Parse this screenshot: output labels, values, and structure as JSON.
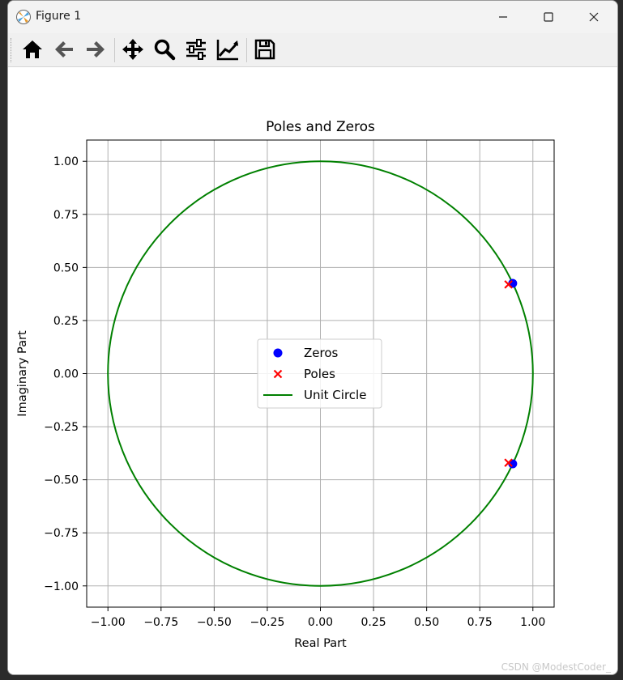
{
  "window": {
    "title": "Figure 1",
    "icons": {
      "app": "matplotlib-figure-icon",
      "minimize": "minimize-icon",
      "maximize": "maximize-icon",
      "close": "close-icon"
    }
  },
  "toolbar": {
    "buttons": [
      {
        "name": "home-button",
        "icon": "home-icon"
      },
      {
        "name": "back-button",
        "icon": "arrow-left-icon"
      },
      {
        "name": "forward-button",
        "icon": "arrow-right-icon"
      },
      {
        "name": "pan-button",
        "icon": "move-icon"
      },
      {
        "name": "zoom-button",
        "icon": "magnifier-icon"
      },
      {
        "name": "subplots-button",
        "icon": "sliders-icon"
      },
      {
        "name": "axes-edit-button",
        "icon": "line-chart-icon"
      },
      {
        "name": "save-button",
        "icon": "floppy-disk-icon"
      }
    ]
  },
  "watermark": "CSDN @ModestCoder_",
  "colors": {
    "zeros": "#0000ff",
    "poles": "#ff0000",
    "unit_circle": "#008000",
    "grid": "#b0b0b0"
  },
  "chart_data": {
    "type": "scatter",
    "title": "Poles and Zeros",
    "xlabel": "Real Part",
    "ylabel": "Imaginary Part",
    "xlim": [
      -1.1,
      1.1
    ],
    "ylim": [
      -1.1,
      1.1
    ],
    "xticks": [
      -1.0,
      -0.75,
      -0.5,
      -0.25,
      0.0,
      0.25,
      0.5,
      0.75,
      1.0
    ],
    "yticks": [
      1.0,
      0.75,
      0.5,
      0.25,
      0.0,
      -0.25,
      -0.5,
      -0.75,
      -1.0
    ],
    "xtick_labels": [
      "−1.00",
      "−0.75",
      "−0.50",
      "−0.25",
      "0.00",
      "0.25",
      "0.50",
      "0.75",
      "1.00"
    ],
    "ytick_labels": [
      "1.00",
      "0.75",
      "0.50",
      "0.25",
      "0.00",
      "−0.25",
      "−0.50",
      "−0.75",
      "−1.00"
    ],
    "grid": true,
    "legend_position": "center",
    "series": [
      {
        "name": "Zeros",
        "marker": "circle",
        "color": "#0000ff",
        "points": [
          {
            "x": 0.905,
            "y": 0.425
          },
          {
            "x": 0.905,
            "y": -0.425
          }
        ]
      },
      {
        "name": "Poles",
        "marker": "x",
        "color": "#ff0000",
        "points": [
          {
            "x": 0.885,
            "y": 0.42
          },
          {
            "x": 0.885,
            "y": -0.42
          }
        ]
      },
      {
        "name": "Unit Circle",
        "marker": "line",
        "color": "#008000",
        "circle": {
          "cx": 0,
          "cy": 0,
          "r": 1
        }
      }
    ]
  }
}
